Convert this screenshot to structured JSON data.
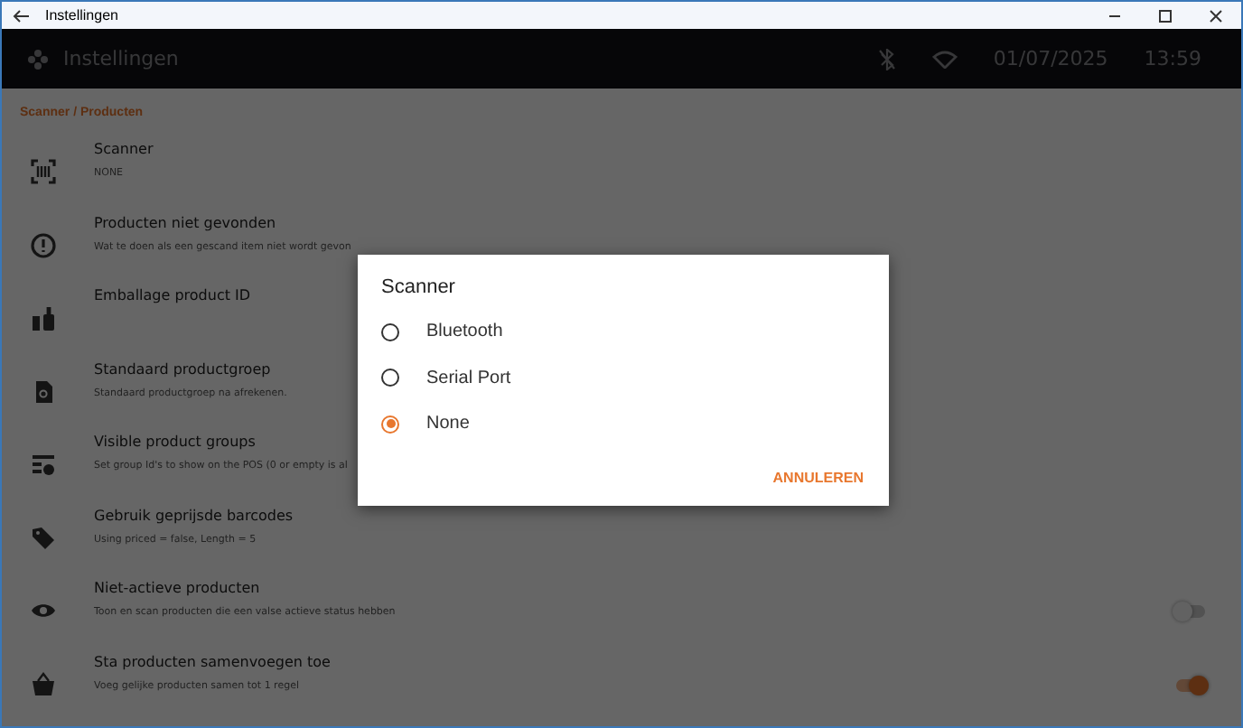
{
  "window": {
    "title": "Instellingen"
  },
  "header": {
    "title": "Instellingen",
    "date": "01/07/2025",
    "time": "13:59"
  },
  "section": {
    "title": "Scanner / Producten"
  },
  "settings": [
    {
      "title": "Scanner",
      "subtitle": "NONE"
    },
    {
      "title": "Producten niet gevonden",
      "subtitle": "Wat te doen als een gescand item niet wordt gevon"
    },
    {
      "title": "Emballage product ID"
    },
    {
      "title": "Standaard productgroep",
      "subtitle": "Standaard productgroep na afrekenen."
    },
    {
      "title": "Visible product groups",
      "subtitle": "Set group Id's to show on the POS (0 or empty is al"
    },
    {
      "title": "Gebruik geprijsde barcodes",
      "subtitle": "Using priced = false, Length = 5"
    },
    {
      "title": "Niet-actieve producten",
      "subtitle": "Toon en scan producten die een valse actieve status hebben",
      "toggle": {
        "on": false
      }
    },
    {
      "title": "Sta producten samenvoegen toe",
      "subtitle": "Voeg gelijke producten samen tot 1 regel",
      "toggle": {
        "on": true
      }
    }
  ],
  "dialog": {
    "title": "Scanner",
    "options": [
      {
        "label": "Bluetooth",
        "selected": false
      },
      {
        "label": "Serial Port",
        "selected": false
      },
      {
        "label": "None",
        "selected": true
      }
    ],
    "button": "ANNULEREN"
  }
}
